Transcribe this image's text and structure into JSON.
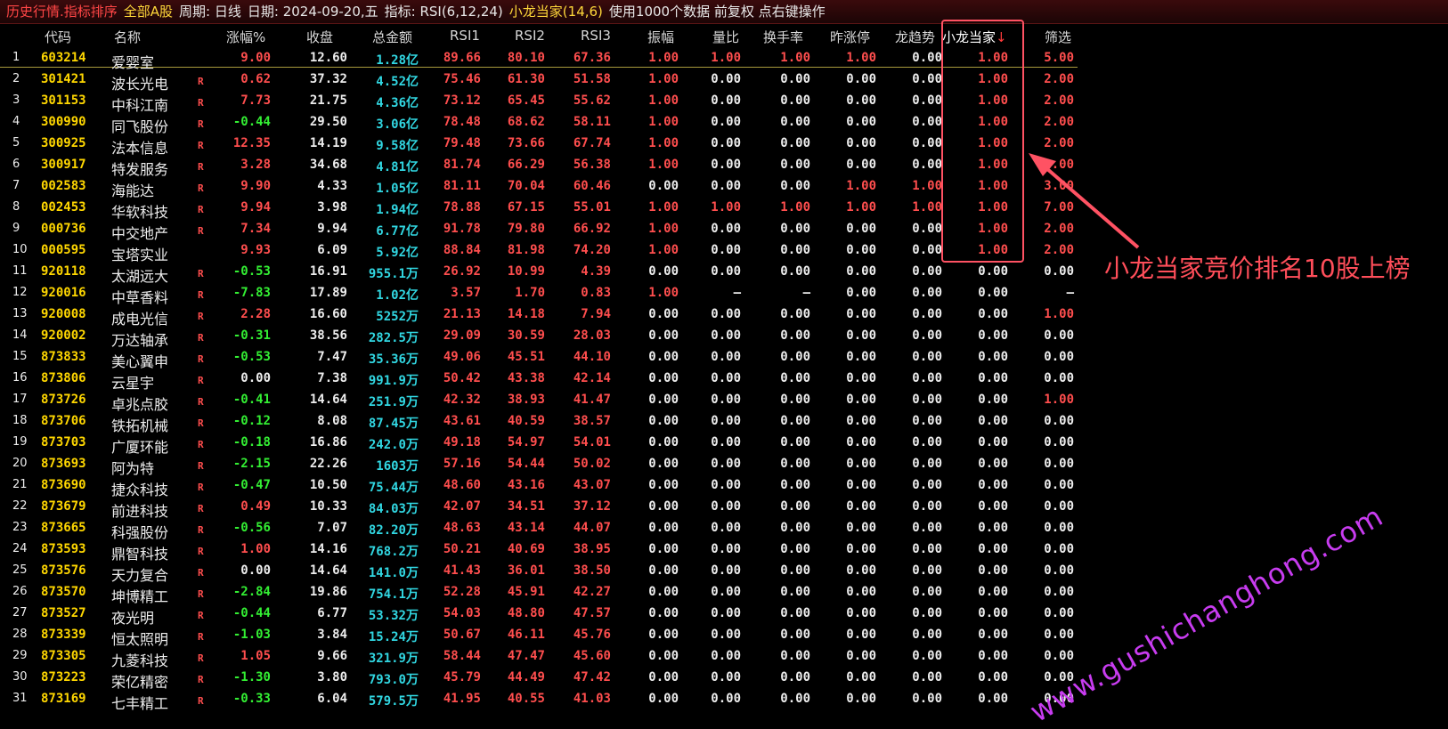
{
  "titlebar": {
    "title": "历史行情.指标排序",
    "scope": "全部A股",
    "period": "周期: 日线",
    "date": "日期: 2024-09-20,五",
    "indicator_label": "指标: RSI(6,12,24)",
    "xiaolong": "小龙当家(14,6)",
    "usage": "使用1000个数据 前复权 点右键操作"
  },
  "table": {
    "columns": [
      "代码",
      "名称",
      "涨幅%",
      "收盘",
      "总金额",
      "RSI1",
      "RSI2",
      "RSI3",
      "振幅",
      "量比",
      "换手率",
      "昨涨停",
      "龙趋势",
      "小龙当家↓",
      "筛选"
    ],
    "rows": [
      {
        "n": "1",
        "code": "603214",
        "name": "爱婴室",
        "r": "",
        "chg": "9.00",
        "close": "12.60",
        "amt": "1.28亿",
        "rsi1": "89.66",
        "rsi2": "80.10",
        "rsi3": "67.36",
        "amp": "1.00",
        "vr": "1.00",
        "turn": "1.00",
        "ylimit": "1.00",
        "dragon": "0.00",
        "xl": "1.00",
        "filter": "5.00"
      },
      {
        "n": "2",
        "code": "301421",
        "name": "波长光电",
        "r": "R",
        "chg": "0.62",
        "close": "37.32",
        "amt": "4.52亿",
        "rsi1": "75.46",
        "rsi2": "61.30",
        "rsi3": "51.58",
        "amp": "1.00",
        "vr": "0.00",
        "turn": "0.00",
        "ylimit": "0.00",
        "dragon": "0.00",
        "xl": "1.00",
        "filter": "2.00"
      },
      {
        "n": "3",
        "code": "301153",
        "name": "中科江南",
        "r": "R",
        "chg": "7.73",
        "close": "21.75",
        "amt": "4.36亿",
        "rsi1": "73.12",
        "rsi2": "65.45",
        "rsi3": "55.62",
        "amp": "1.00",
        "vr": "0.00",
        "turn": "0.00",
        "ylimit": "0.00",
        "dragon": "0.00",
        "xl": "1.00",
        "filter": "2.00"
      },
      {
        "n": "4",
        "code": "300990",
        "name": "同飞股份",
        "r": "R",
        "chg": "-0.44",
        "close": "29.50",
        "amt": "3.06亿",
        "rsi1": "78.48",
        "rsi2": "68.62",
        "rsi3": "58.11",
        "amp": "1.00",
        "vr": "0.00",
        "turn": "0.00",
        "ylimit": "0.00",
        "dragon": "0.00",
        "xl": "1.00",
        "filter": "2.00"
      },
      {
        "n": "5",
        "code": "300925",
        "name": "法本信息",
        "r": "R",
        "chg": "12.35",
        "close": "14.19",
        "amt": "9.58亿",
        "rsi1": "79.48",
        "rsi2": "73.66",
        "rsi3": "67.74",
        "amp": "1.00",
        "vr": "0.00",
        "turn": "0.00",
        "ylimit": "0.00",
        "dragon": "0.00",
        "xl": "1.00",
        "filter": "2.00"
      },
      {
        "n": "6",
        "code": "300917",
        "name": "特发服务",
        "r": "R",
        "chg": "3.28",
        "close": "34.68",
        "amt": "4.81亿",
        "rsi1": "81.74",
        "rsi2": "66.29",
        "rsi3": "56.38",
        "amp": "1.00",
        "vr": "0.00",
        "turn": "0.00",
        "ylimit": "0.00",
        "dragon": "0.00",
        "xl": "1.00",
        "filter": "2.00"
      },
      {
        "n": "7",
        "code": "002583",
        "name": "海能达",
        "r": "R",
        "chg": "9.90",
        "close": "4.33",
        "amt": "1.05亿",
        "rsi1": "81.11",
        "rsi2": "70.04",
        "rsi3": "60.46",
        "amp": "0.00",
        "vr": "0.00",
        "turn": "0.00",
        "ylimit": "1.00",
        "dragon": "1.00",
        "xl": "1.00",
        "filter": "3.00"
      },
      {
        "n": "8",
        "code": "002453",
        "name": "华软科技",
        "r": "R",
        "chg": "9.94",
        "close": "3.98",
        "amt": "1.94亿",
        "rsi1": "78.88",
        "rsi2": "67.15",
        "rsi3": "55.01",
        "amp": "1.00",
        "vr": "1.00",
        "turn": "1.00",
        "ylimit": "1.00",
        "dragon": "1.00",
        "xl": "1.00",
        "filter": "7.00"
      },
      {
        "n": "9",
        "code": "000736",
        "name": "中交地产",
        "r": "R",
        "chg": "7.34",
        "close": "9.94",
        "amt": "6.77亿",
        "rsi1": "91.78",
        "rsi2": "79.80",
        "rsi3": "66.92",
        "amp": "1.00",
        "vr": "0.00",
        "turn": "0.00",
        "ylimit": "0.00",
        "dragon": "0.00",
        "xl": "1.00",
        "filter": "2.00"
      },
      {
        "n": "10",
        "code": "000595",
        "name": "宝塔实业",
        "r": "",
        "chg": "9.93",
        "close": "6.09",
        "amt": "5.92亿",
        "rsi1": "88.84",
        "rsi2": "81.98",
        "rsi3": "74.20",
        "amp": "1.00",
        "vr": "0.00",
        "turn": "0.00",
        "ylimit": "0.00",
        "dragon": "0.00",
        "xl": "1.00",
        "filter": "2.00"
      },
      {
        "n": "11",
        "code": "920118",
        "name": "太湖远大",
        "r": "R",
        "chg": "-0.53",
        "close": "16.91",
        "amt": "955.1万",
        "rsi1": "26.92",
        "rsi2": "10.99",
        "rsi3": "4.39",
        "amp": "0.00",
        "vr": "0.00",
        "turn": "0.00",
        "ylimit": "0.00",
        "dragon": "0.00",
        "xl": "0.00",
        "filter": "0.00"
      },
      {
        "n": "12",
        "code": "920016",
        "name": "中草香料",
        "r": "R",
        "chg": "-7.83",
        "close": "17.89",
        "amt": "1.02亿",
        "rsi1": "3.57",
        "rsi2": "1.70",
        "rsi3": "0.83",
        "amp": "1.00",
        "vr": "—",
        "turn": "—",
        "ylimit": "0.00",
        "dragon": "0.00",
        "xl": "0.00",
        "filter": "—"
      },
      {
        "n": "13",
        "code": "920008",
        "name": "成电光信",
        "r": "R",
        "chg": "2.28",
        "close": "16.60",
        "amt": "5252万",
        "rsi1": "21.13",
        "rsi2": "14.18",
        "rsi3": "7.94",
        "amp": "0.00",
        "vr": "0.00",
        "turn": "0.00",
        "ylimit": "0.00",
        "dragon": "0.00",
        "xl": "0.00",
        "filter": "1.00"
      },
      {
        "n": "14",
        "code": "920002",
        "name": "万达轴承",
        "r": "R",
        "chg": "-0.31",
        "close": "38.56",
        "amt": "282.5万",
        "rsi1": "29.09",
        "rsi2": "30.59",
        "rsi3": "28.03",
        "amp": "0.00",
        "vr": "0.00",
        "turn": "0.00",
        "ylimit": "0.00",
        "dragon": "0.00",
        "xl": "0.00",
        "filter": "0.00"
      },
      {
        "n": "15",
        "code": "873833",
        "name": "美心翼申",
        "r": "R",
        "chg": "-0.53",
        "close": "7.47",
        "amt": "35.36万",
        "rsi1": "49.06",
        "rsi2": "45.51",
        "rsi3": "44.10",
        "amp": "0.00",
        "vr": "0.00",
        "turn": "0.00",
        "ylimit": "0.00",
        "dragon": "0.00",
        "xl": "0.00",
        "filter": "0.00"
      },
      {
        "n": "16",
        "code": "873806",
        "name": "云星宇",
        "r": "R",
        "chg": "0.00",
        "close": "7.38",
        "amt": "991.9万",
        "rsi1": "50.42",
        "rsi2": "43.38",
        "rsi3": "42.14",
        "amp": "0.00",
        "vr": "0.00",
        "turn": "0.00",
        "ylimit": "0.00",
        "dragon": "0.00",
        "xl": "0.00",
        "filter": "0.00"
      },
      {
        "n": "17",
        "code": "873726",
        "name": "卓兆点胶",
        "r": "R",
        "chg": "-0.41",
        "close": "14.64",
        "amt": "251.9万",
        "rsi1": "42.32",
        "rsi2": "38.93",
        "rsi3": "41.47",
        "amp": "0.00",
        "vr": "0.00",
        "turn": "0.00",
        "ylimit": "0.00",
        "dragon": "0.00",
        "xl": "0.00",
        "filter": "1.00"
      },
      {
        "n": "18",
        "code": "873706",
        "name": "铁拓机械",
        "r": "R",
        "chg": "-0.12",
        "close": "8.08",
        "amt": "87.45万",
        "rsi1": "43.61",
        "rsi2": "40.59",
        "rsi3": "38.57",
        "amp": "0.00",
        "vr": "0.00",
        "turn": "0.00",
        "ylimit": "0.00",
        "dragon": "0.00",
        "xl": "0.00",
        "filter": "0.00"
      },
      {
        "n": "19",
        "code": "873703",
        "name": "广厦环能",
        "r": "R",
        "chg": "-0.18",
        "close": "16.86",
        "amt": "242.0万",
        "rsi1": "49.18",
        "rsi2": "54.97",
        "rsi3": "54.01",
        "amp": "0.00",
        "vr": "0.00",
        "turn": "0.00",
        "ylimit": "0.00",
        "dragon": "0.00",
        "xl": "0.00",
        "filter": "0.00"
      },
      {
        "n": "20",
        "code": "873693",
        "name": "阿为特",
        "r": "R",
        "chg": "-2.15",
        "close": "22.26",
        "amt": "1603万",
        "rsi1": "57.16",
        "rsi2": "54.44",
        "rsi3": "50.02",
        "amp": "0.00",
        "vr": "0.00",
        "turn": "0.00",
        "ylimit": "0.00",
        "dragon": "0.00",
        "xl": "0.00",
        "filter": "0.00"
      },
      {
        "n": "21",
        "code": "873690",
        "name": "捷众科技",
        "r": "R",
        "chg": "-0.47",
        "close": "10.50",
        "amt": "75.44万",
        "rsi1": "48.60",
        "rsi2": "43.16",
        "rsi3": "43.07",
        "amp": "0.00",
        "vr": "0.00",
        "turn": "0.00",
        "ylimit": "0.00",
        "dragon": "0.00",
        "xl": "0.00",
        "filter": "0.00"
      },
      {
        "n": "22",
        "code": "873679",
        "name": "前进科技",
        "r": "R",
        "chg": "0.49",
        "close": "10.33",
        "amt": "84.03万",
        "rsi1": "42.07",
        "rsi2": "34.51",
        "rsi3": "37.12",
        "amp": "0.00",
        "vr": "0.00",
        "turn": "0.00",
        "ylimit": "0.00",
        "dragon": "0.00",
        "xl": "0.00",
        "filter": "0.00"
      },
      {
        "n": "23",
        "code": "873665",
        "name": "科强股份",
        "r": "R",
        "chg": "-0.56",
        "close": "7.07",
        "amt": "82.20万",
        "rsi1": "48.63",
        "rsi2": "43.14",
        "rsi3": "44.07",
        "amp": "0.00",
        "vr": "0.00",
        "turn": "0.00",
        "ylimit": "0.00",
        "dragon": "0.00",
        "xl": "0.00",
        "filter": "0.00"
      },
      {
        "n": "24",
        "code": "873593",
        "name": "鼎智科技",
        "r": "R",
        "chg": "1.00",
        "close": "14.16",
        "amt": "768.2万",
        "rsi1": "50.21",
        "rsi2": "40.69",
        "rsi3": "38.95",
        "amp": "0.00",
        "vr": "0.00",
        "turn": "0.00",
        "ylimit": "0.00",
        "dragon": "0.00",
        "xl": "0.00",
        "filter": "0.00"
      },
      {
        "n": "25",
        "code": "873576",
        "name": "天力复合",
        "r": "R",
        "chg": "0.00",
        "close": "14.64",
        "amt": "141.0万",
        "rsi1": "41.43",
        "rsi2": "36.01",
        "rsi3": "38.50",
        "amp": "0.00",
        "vr": "0.00",
        "turn": "0.00",
        "ylimit": "0.00",
        "dragon": "0.00",
        "xl": "0.00",
        "filter": "0.00"
      },
      {
        "n": "26",
        "code": "873570",
        "name": "坤博精工",
        "r": "R",
        "chg": "-2.84",
        "close": "19.86",
        "amt": "754.1万",
        "rsi1": "52.28",
        "rsi2": "45.91",
        "rsi3": "42.27",
        "amp": "0.00",
        "vr": "0.00",
        "turn": "0.00",
        "ylimit": "0.00",
        "dragon": "0.00",
        "xl": "0.00",
        "filter": "0.00"
      },
      {
        "n": "27",
        "code": "873527",
        "name": "夜光明",
        "r": "R",
        "chg": "-0.44",
        "close": "6.77",
        "amt": "53.32万",
        "rsi1": "54.03",
        "rsi2": "48.80",
        "rsi3": "47.57",
        "amp": "0.00",
        "vr": "0.00",
        "turn": "0.00",
        "ylimit": "0.00",
        "dragon": "0.00",
        "xl": "0.00",
        "filter": "0.00"
      },
      {
        "n": "28",
        "code": "873339",
        "name": "恒太照明",
        "r": "R",
        "chg": "-1.03",
        "close": "3.84",
        "amt": "15.24万",
        "rsi1": "50.67",
        "rsi2": "46.11",
        "rsi3": "45.76",
        "amp": "0.00",
        "vr": "0.00",
        "turn": "0.00",
        "ylimit": "0.00",
        "dragon": "0.00",
        "xl": "0.00",
        "filter": "0.00"
      },
      {
        "n": "29",
        "code": "873305",
        "name": "九菱科技",
        "r": "R",
        "chg": "1.05",
        "close": "9.66",
        "amt": "321.9万",
        "rsi1": "58.44",
        "rsi2": "47.47",
        "rsi3": "45.60",
        "amp": "0.00",
        "vr": "0.00",
        "turn": "0.00",
        "ylimit": "0.00",
        "dragon": "0.00",
        "xl": "0.00",
        "filter": "0.00"
      },
      {
        "n": "30",
        "code": "873223",
        "name": "荣亿精密",
        "r": "R",
        "chg": "-1.30",
        "close": "3.80",
        "amt": "793.0万",
        "rsi1": "45.79",
        "rsi2": "44.49",
        "rsi3": "47.42",
        "amp": "0.00",
        "vr": "0.00",
        "turn": "0.00",
        "ylimit": "0.00",
        "dragon": "0.00",
        "xl": "0.00",
        "filter": "0.00"
      },
      {
        "n": "31",
        "code": "873169",
        "name": "七丰精工",
        "r": "R",
        "chg": "-0.33",
        "close": "6.04",
        "amt": "579.5万",
        "rsi1": "41.95",
        "rsi2": "40.55",
        "rsi3": "41.03",
        "amp": "0.00",
        "vr": "0.00",
        "turn": "0.00",
        "ylimit": "0.00",
        "dragon": "0.00",
        "xl": "0.00",
        "filter": "0.00"
      }
    ]
  },
  "annotation": "小龙当家竞价排名10股上榜",
  "watermark": "www.gushichanghong.com",
  "colors": {
    "up": "#ff4e4e",
    "down": "#33ee33",
    "flat": "#ededed",
    "code": "#ffd700",
    "amount": "#31d7e2",
    "highlight": "#ff5263"
  }
}
